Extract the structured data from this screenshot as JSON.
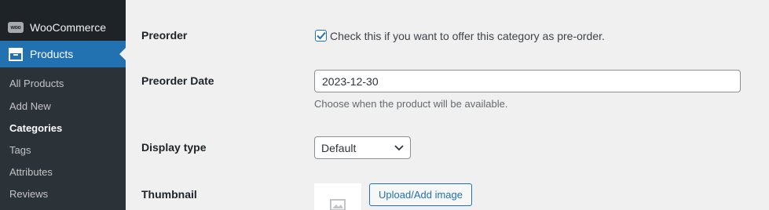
{
  "sidebar": {
    "woocommerce_label": "WooCommerce",
    "woo_logo_text": "woo",
    "products_label": "Products",
    "submenu": [
      {
        "label": "All Products"
      },
      {
        "label": "Add New"
      },
      {
        "label": "Categories",
        "current": true
      },
      {
        "label": "Tags"
      },
      {
        "label": "Attributes"
      },
      {
        "label": "Reviews"
      }
    ]
  },
  "form": {
    "preorder": {
      "label": "Preorder",
      "checkbox_checked": true,
      "checkbox_text": "Check this if you want to offer this category as pre-order."
    },
    "preorder_date": {
      "label": "Preorder Date",
      "value": "2023-12-30",
      "description": "Choose when the product will be available."
    },
    "display_type": {
      "label": "Display type",
      "selected": "Default"
    },
    "thumbnail": {
      "label": "Thumbnail",
      "button_label": "Upload/Add image"
    }
  },
  "icons": {
    "woocommerce": "woocommerce-icon",
    "products": "archive-box-icon",
    "check": "checkmark-icon",
    "select_caret": "chevron-down-icon",
    "thumbnail_placeholder": "image-placeholder-icon"
  },
  "colors": {
    "sidebar_bg": "#1d2327",
    "submenu_bg": "#2c3338",
    "accent": "#2271b1",
    "page_bg": "#f0f0f1"
  }
}
